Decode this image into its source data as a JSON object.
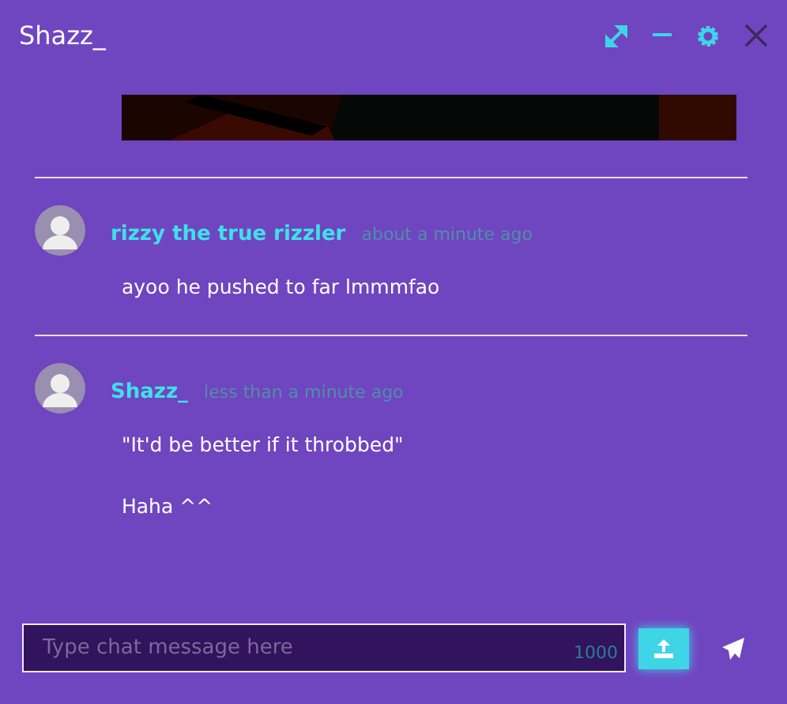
{
  "window": {
    "title": "Shazz_"
  },
  "messages": [
    {
      "author": "rizzy the true rizzler",
      "time": "about a minute ago",
      "paragraphs": [
        "ayoo he pushed to far lmmmfao"
      ]
    },
    {
      "author": "Shazz_",
      "time": "less than a minute ago",
      "paragraphs": [
        "\"It'd be better if it throbbed\"",
        "Haha ^^"
      ]
    }
  ],
  "composer": {
    "placeholder": "Type chat message here",
    "counter": "1000"
  }
}
